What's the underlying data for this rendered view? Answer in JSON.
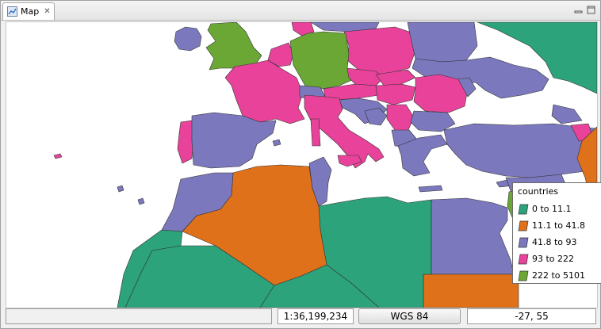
{
  "tab": {
    "label": "Map",
    "icon": "map-icon",
    "close_icon": "close-icon"
  },
  "window_controls": {
    "minimize_icon": "minimize-icon",
    "maximize_icon": "maximize-icon"
  },
  "legend": {
    "title": "countries",
    "items": [
      {
        "label": "0 to 11.1",
        "color": "#2ca37b"
      },
      {
        "label": "11.1 to 41.8",
        "color": "#e0711b"
      },
      {
        "label": "41.8 to 93",
        "color": "#7c78be"
      },
      {
        "label": "93 to 222",
        "color": "#e8429a"
      },
      {
        "label": "222 to 5101",
        "color": "#6aa734"
      }
    ]
  },
  "statusbar": {
    "scale": "1:36,199,234",
    "crs": "WGS 84",
    "coords": "-27, 55"
  },
  "colors": {
    "teal": "#2ca37b",
    "orange": "#e0711b",
    "purple": "#7c78be",
    "pink": "#e8429a",
    "green": "#6aa734",
    "sea": "#ffffff"
  }
}
